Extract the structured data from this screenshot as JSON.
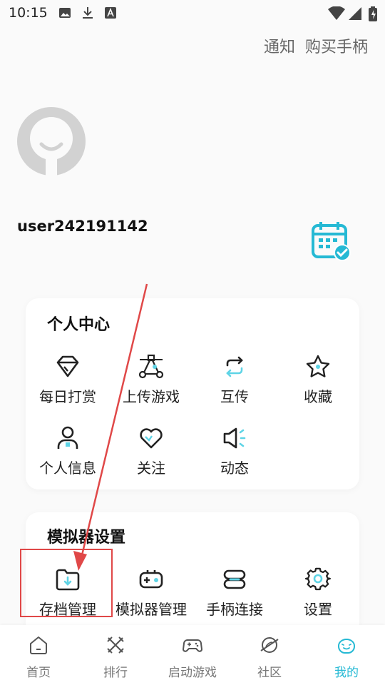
{
  "status_bar": {
    "time": "10:15"
  },
  "header": {
    "notify_label": "通知",
    "buy_gamepad_label": "购买手柄"
  },
  "profile": {
    "username": "user242191142"
  },
  "personal_center": {
    "title": "个人中心",
    "items": [
      {
        "label": "每日打赏",
        "icon": "diamond-icon"
      },
      {
        "label": "上传游戏",
        "icon": "upload-nodes-icon"
      },
      {
        "label": "互传",
        "icon": "transfer-icon"
      },
      {
        "label": "收藏",
        "icon": "star-icon"
      },
      {
        "label": "个人信息",
        "icon": "person-icon"
      },
      {
        "label": "关注",
        "icon": "heart-icon"
      },
      {
        "label": "动态",
        "icon": "megaphone-icon"
      }
    ]
  },
  "emulator_settings": {
    "title": "模拟器设置",
    "items": [
      {
        "label": "存档管理",
        "icon": "folder-download-icon"
      },
      {
        "label": "模拟器管理",
        "icon": "emulator-icon"
      },
      {
        "label": "手柄连接",
        "icon": "link-icon"
      },
      {
        "label": "设置",
        "icon": "gear-icon"
      }
    ]
  },
  "bottom_nav": {
    "items": [
      {
        "label": "首页",
        "icon": "home-icon"
      },
      {
        "label": "排行",
        "icon": "ranking-icon"
      },
      {
        "label": "启动游戏",
        "icon": "gamepad-icon"
      },
      {
        "label": "社区",
        "icon": "planet-icon"
      },
      {
        "label": "我的",
        "icon": "smile-face-icon",
        "active": true
      }
    ]
  },
  "colors": {
    "accent": "#25b9d4",
    "annotation": "#e04848"
  }
}
